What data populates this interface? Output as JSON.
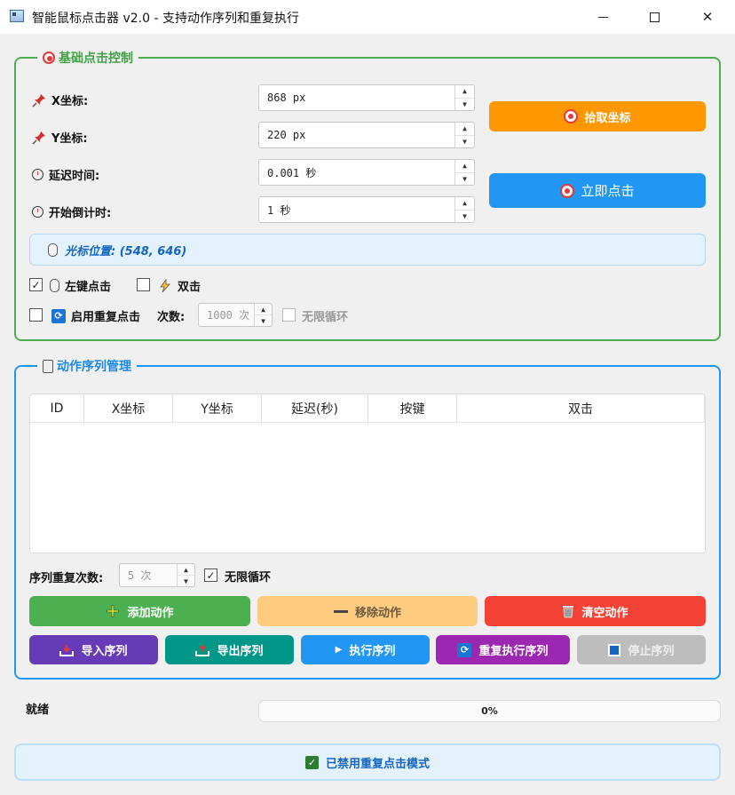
{
  "window": {
    "title": "智能鼠标点击器 v2.0 - 支持动作序列和重复执行",
    "min_glyph": "",
    "close_glyph": "✕"
  },
  "basic": {
    "title": "基础点击控制",
    "x_label": "X坐标:",
    "x_value": "868 px",
    "y_label": "Y坐标:",
    "y_value": "220 px",
    "delay_label": "延迟时间:",
    "delay_value": "0.001 秒",
    "countdown_label": "开始倒计时:",
    "countdown_value": "1 秒",
    "pick_button": "拾取坐标",
    "click_button": "立即点击",
    "cursor_position": "光标位置: (548, 646)",
    "left_click_label": "左键点击",
    "left_click_checked": true,
    "double_click_label": "双击",
    "double_click_checked": false,
    "repeat_label": "启用重复点击",
    "repeat_checked": false,
    "count_label": "次数:",
    "count_value": "1000 次",
    "infinite_label": "无限循环",
    "infinite_checked": false
  },
  "sequence": {
    "title": "动作序列管理",
    "columns": [
      "ID",
      "X坐标",
      "Y坐标",
      "延迟(秒)",
      "按键",
      "双击"
    ],
    "rows": [],
    "repeat_label": "序列重复次数:",
    "repeat_value": "5 次",
    "infinite_label": "无限循环",
    "infinite_checked": true,
    "add_button": "添加动作",
    "remove_button": "移除动作",
    "clear_button": "清空动作",
    "import_button": "导入序列",
    "export_button": "导出序列",
    "exec_button": "执行序列",
    "repeat_exec_button": "重复执行序列",
    "stop_button": "停止序列"
  },
  "status": {
    "text": "就绪",
    "progress": 0,
    "progress_text": "0%"
  },
  "footer": {
    "text": "已禁用重复点击模式"
  },
  "colors": {
    "basic_border": "#4caf50",
    "sequence_border": "#2196f3",
    "pick": "#ff9800",
    "click": "#2196f3",
    "add": "#4caf50",
    "remove": "#ffcc80",
    "clear": "#f44336",
    "import": "#673ab7",
    "export": "#009688",
    "exec": "#2196f3",
    "repeat_exec": "#9c27b0",
    "stop": "#bdbdbd"
  }
}
